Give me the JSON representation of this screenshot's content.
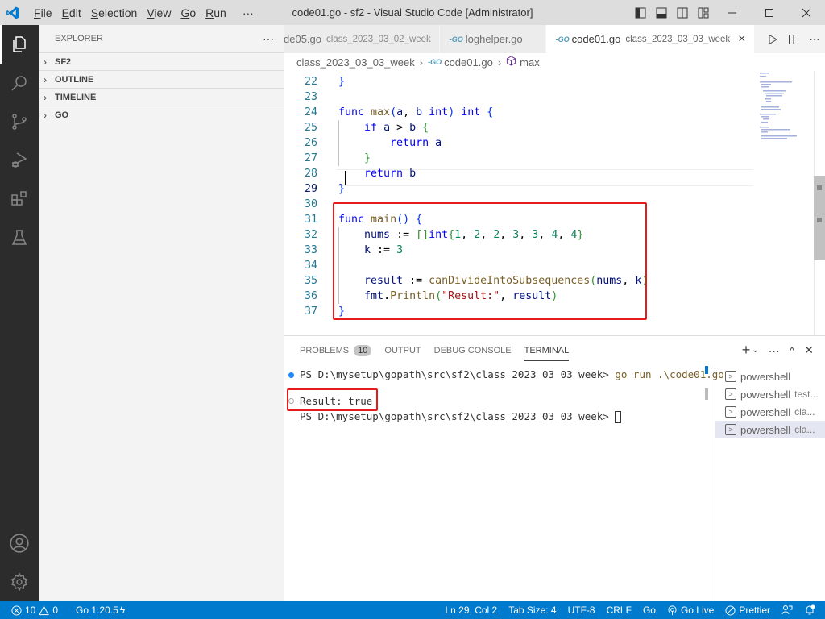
{
  "titlebar": {
    "menu": [
      {
        "label": "File",
        "u": "F",
        "rest": "ile"
      },
      {
        "label": "Edit",
        "u": "E",
        "rest": "dit"
      },
      {
        "label": "Selection",
        "u": "S",
        "rest": "election"
      },
      {
        "label": "View",
        "u": "V",
        "rest": "iew"
      },
      {
        "label": "Go",
        "u": "G",
        "rest": "o"
      },
      {
        "label": "Run",
        "u": "R",
        "rest": "un"
      }
    ],
    "more": "···",
    "title": "code01.go - sf2 - Visual Studio Code [Administrator]"
  },
  "sidebar": {
    "header": "EXPLORER",
    "more": "···",
    "sections": [
      "SF2",
      "OUTLINE",
      "TIMELINE",
      "GO"
    ]
  },
  "tabs": [
    {
      "name": "de05.go",
      "desc": "class_2023_03_02_week",
      "active": false
    },
    {
      "name": "loghelper.go",
      "desc": "",
      "active": false
    },
    {
      "name": "code01.go",
      "desc": "class_2023_03_03_week",
      "active": true
    }
  ],
  "tab_close": "×",
  "breadcrumb": {
    "folder": "class_2023_03_03_week",
    "file": "code01.go",
    "symbol": "max"
  },
  "editor": {
    "lines": [
      {
        "n": "22",
        "html": "<span class='br1'>}</span>"
      },
      {
        "n": "23",
        "html": ""
      },
      {
        "n": "24",
        "html": "<span class='kw'>func</span> <span class='fn'>max</span><span class='br1'>(</span><span class='var'>a</span>, <span class='var'>b</span> <span class='kw'>int</span><span class='br1'>)</span> <span class='kw'>int</span> <span class='br1'>{</span>"
      },
      {
        "n": "25",
        "html": "    <span class='kw'>if</span> <span class='var'>a</span> &gt; <span class='var'>b</span> <span class='br2'>{</span>"
      },
      {
        "n": "26",
        "html": "        <span class='kw'>return</span> <span class='var'>a</span>"
      },
      {
        "n": "27",
        "html": "    <span class='br2'>}</span>"
      },
      {
        "n": "28",
        "html": "    <span class='kw'>return</span> <span class='var'>b</span>"
      },
      {
        "n": "29",
        "html": "<span class='br1'>}</span>"
      },
      {
        "n": "30",
        "html": ""
      },
      {
        "n": "31",
        "html": "<span class='kw'>func</span> <span class='fn'>main</span><span class='br1'>()</span> <span class='br1'>{</span>"
      },
      {
        "n": "32",
        "html": "    <span class='var'>nums</span> := <span class='br2'>[]</span><span class='kw'>int</span><span class='br2'>{</span><span class='num'>1</span>, <span class='num'>2</span>, <span class='num'>2</span>, <span class='num'>3</span>, <span class='num'>3</span>, <span class='num'>4</span>, <span class='num'>4</span><span class='br2'>}</span>"
      },
      {
        "n": "33",
        "html": "    <span class='var'>k</span> := <span class='num'>3</span>"
      },
      {
        "n": "34",
        "html": ""
      },
      {
        "n": "35",
        "html": "    <span class='var'>result</span> := <span class='fn'>canDivideIntoSubsequences</span><span class='br2'>(</span><span class='var'>nums</span>, <span class='var'>k</span><span class='br2'>)</span>"
      },
      {
        "n": "36",
        "html": "    <span class='var'>fmt</span>.<span class='fn'>Println</span><span class='br2'>(</span><span class='str'>\"Result:\"</span>, <span class='var'>result</span><span class='br2'>)</span>"
      },
      {
        "n": "37",
        "html": "<span class='br1'>}</span>"
      }
    ],
    "current_line": "29"
  },
  "panel": {
    "tabs": [
      "PROBLEMS",
      "OUTPUT",
      "DEBUG CONSOLE",
      "TERMINAL"
    ],
    "problems_count": "10",
    "active_tab": "TERMINAL",
    "terminal": {
      "prompt1": "PS D:\\mysetup\\gopath\\src\\sf2\\class_2023_03_03_week> ",
      "command": "go run .\\code01.go",
      "output": "Result: true",
      "prompt2": "PS D:\\mysetup\\gopath\\src\\sf2\\class_2023_03_03_week> "
    },
    "terminals": [
      {
        "name": "powershell",
        "desc": ""
      },
      {
        "name": "powershell",
        "desc": "test..."
      },
      {
        "name": "powershell",
        "desc": "cla..."
      },
      {
        "name": "powershell",
        "desc": "cla..."
      }
    ]
  },
  "statusbar": {
    "errors": "10",
    "warnings": "0",
    "go_version": "Go 1.20.5",
    "position": "Ln 29, Col 2",
    "tab_size": "Tab Size: 4",
    "encoding": "UTF-8",
    "eol": "CRLF",
    "language": "Go",
    "go_live": "Go Live",
    "prettier": "Prettier"
  },
  "colors": {
    "statusbar": "#007acc",
    "highlight_box": "#e51c1c",
    "activitybar": "#2c2c2c"
  }
}
